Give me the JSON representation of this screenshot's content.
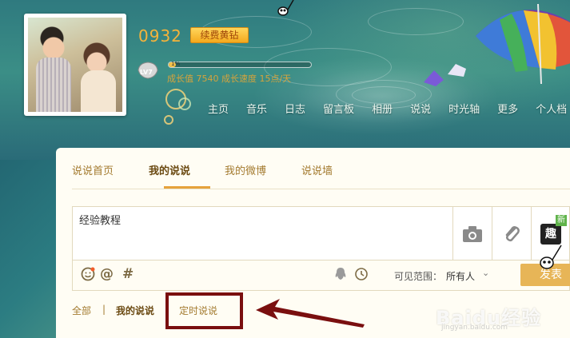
{
  "profile": {
    "qq_number": "0932",
    "vip_button": "续费黄钻",
    "level_icon": "LV7",
    "progress_fraction": 0.05,
    "progress_text": "1%",
    "growth_text": "成长值 7540 成长速度 15点/天"
  },
  "nav": {
    "items": [
      "主页",
      "音乐",
      "日志",
      "留言板",
      "相册",
      "说说",
      "时光轴",
      "更多",
      "个人档"
    ]
  },
  "tabs": {
    "items": [
      "说说首页",
      "我的说说",
      "我的微博",
      "说说墙"
    ],
    "active": "我的说说"
  },
  "editor": {
    "text": "经验教程",
    "new_tag": "新",
    "fun_label": "趣"
  },
  "toolbar": {
    "icons": [
      "smiley-icon",
      "at-icon",
      "hash-icon",
      "qq-icon",
      "clock-icon"
    ],
    "scope_label": "可见范围：",
    "scope_value": "所有人",
    "publish_label": "发表"
  },
  "filters": {
    "all": "全部",
    "separator": "|",
    "mine": "我的说说",
    "timed": "定时说说"
  },
  "watermark": {
    "logo": "Baidu经验",
    "url": "jingyan.baidu.com"
  },
  "colors": {
    "highlight_box": "#7a0f0f",
    "accent": "#e6a23c",
    "publish_button": "#e7b557"
  }
}
